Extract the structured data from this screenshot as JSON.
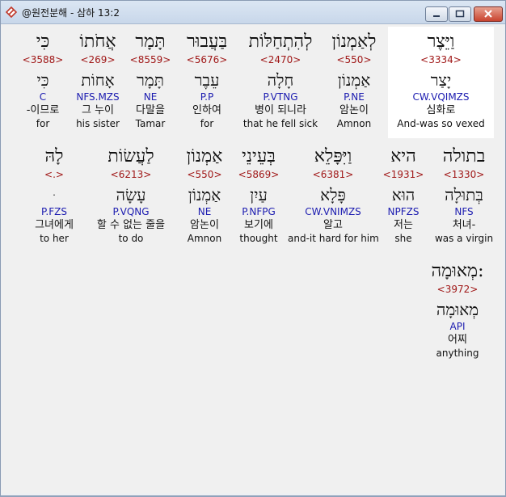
{
  "window": {
    "title": "@원전분해 - 삼하 13:2",
    "buttons": {
      "minimize": "minimize-icon",
      "maximize": "maximize-icon",
      "close": "close-icon"
    }
  },
  "colors": {
    "strong": "#a01818",
    "morph": "#1c1cb0",
    "selected_bg": "#ffffff",
    "content_bg": "#f0f0f0"
  },
  "rows": [
    {
      "words": [
        {
          "heb": "וַיֵּצֶר",
          "strong": "<3334>",
          "lemma": "יָצַר",
          "morph": "CW.VQIMZS",
          "kor": "심화로",
          "eng": "And-was so vexed",
          "selected": true
        },
        {
          "heb": "לְאַמְנוֹן",
          "strong": "<550>",
          "lemma": "אַמְנוֹן",
          "morph": "P.NE",
          "kor": "암논이",
          "eng": "Amnon"
        },
        {
          "heb": "לְהִתְחַלּוֹת",
          "strong": "<2470>",
          "lemma": "חָלָה",
          "morph": "P.VTNG",
          "kor": "병이 되니라",
          "eng": "that he fell sick"
        },
        {
          "heb": "בַּעֲבוּר",
          "strong": "<5676>",
          "lemma": "עֵבֶר",
          "morph": "P.P",
          "kor": "인하여",
          "eng": "for"
        },
        {
          "heb": "תָּמָר",
          "strong": "<8559>",
          "lemma": "תָּמָר",
          "morph": "NE",
          "kor": "다말을",
          "eng": "Tamar"
        },
        {
          "heb": "אֲחֹתוֹ",
          "strong": "<269>",
          "lemma": "אָחוֹת",
          "morph": "NFS.MZS",
          "kor": "그 누이",
          "eng": "his sister"
        },
        {
          "heb": "כִּי",
          "strong": "<3588>",
          "lemma": "כִּי",
          "morph": "C",
          "kor": "-이므로",
          "eng": "for"
        }
      ]
    },
    {
      "words": [
        {
          "heb": "בתולה",
          "strong": "<1330>",
          "lemma": "בְּתוּלָה",
          "morph": "NFS",
          "kor": "처녀-",
          "eng": "was a virgin"
        },
        {
          "heb": "היא",
          "strong": "<1931>",
          "lemma": "הוּא",
          "morph": "NPFZS",
          "kor": "저는",
          "eng": "she"
        },
        {
          "heb": "וַיִּפָּלֵא",
          "strong": "<6381>",
          "lemma": "פָּלָא",
          "morph": "CW.VNIMZS",
          "kor": "알고",
          "eng": "and-it hard for him"
        },
        {
          "heb": "בְּעֵינֵי",
          "strong": "<5869>",
          "lemma": "עַיִן",
          "morph": "P.NFPG",
          "kor": "보기에",
          "eng": "thought"
        },
        {
          "heb": "אַמְנוֹן",
          "strong": "<550>",
          "lemma": "אַמְנוֹן",
          "morph": "NE",
          "kor": "암논이",
          "eng": "Amnon"
        },
        {
          "heb": "לַעֲשׂוֹת",
          "strong": "<6213>",
          "lemma": "עָשָׂה",
          "morph": "P.VQNG",
          "kor": "할 수 없는 줄을",
          "eng": "to do"
        },
        {
          "heb": "לָהּ",
          "strong": "<.>",
          "lemma": "ּ",
          "morph": "P.FZS",
          "kor": "그녀에게",
          "eng": "to her"
        }
      ]
    },
    {
      "words": [
        {
          "heb": "מְאוּמָה:",
          "strong": "<3972>",
          "lemma": "מְאוּמָה",
          "morph": "API",
          "kor": "어찌",
          "eng": "anything"
        }
      ]
    }
  ]
}
